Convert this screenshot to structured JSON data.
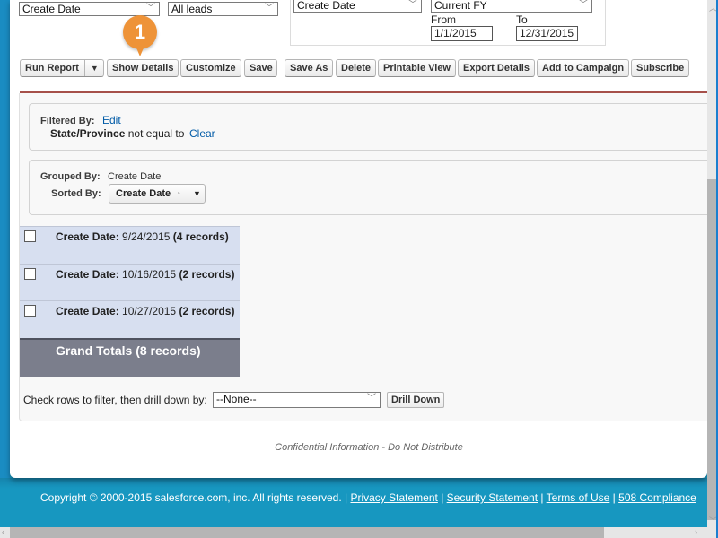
{
  "criteria": {
    "field_select": "Create Date",
    "show_select": "All leads",
    "date_field_select": "Create Date",
    "range_select": "Current FY",
    "from_label": "From",
    "from_value": "1/1/2015",
    "to_label": "To",
    "to_value": "12/31/2015"
  },
  "callout": {
    "number": "1"
  },
  "toolbar": {
    "run_report": "Run Report",
    "run_report_caret": "▼",
    "show_details": "Show Details",
    "customize": "Customize",
    "save": "Save",
    "save_as": "Save As",
    "delete": "Delete",
    "printable_view": "Printable View",
    "export_details": "Export Details",
    "add_to_campaign": "Add to Campaign",
    "subscribe": "Subscribe"
  },
  "filter": {
    "label": "Filtered By:",
    "edit_link": "Edit",
    "field": "State/Province",
    "operator": "not equal to",
    "clear_link": "Clear"
  },
  "grouping": {
    "grouped_label": "Grouped By:",
    "grouped_value": "Create Date",
    "sorted_label": "Sorted By:",
    "sorted_value": "Create Date",
    "sort_arrow": "↑",
    "sort_caret": "▼"
  },
  "groups": [
    {
      "label": "Create Date:",
      "value": "9/24/2015",
      "count": "(4 records)"
    },
    {
      "label": "Create Date:",
      "value": "10/16/2015",
      "count": "(2 records)"
    },
    {
      "label": "Create Date:",
      "value": "10/27/2015",
      "count": "(2 records)"
    }
  ],
  "grand_totals": "Grand Totals (8 records)",
  "drilldown": {
    "label": "Check rows to filter, then drill down by:",
    "select_value": "--None--",
    "button": "Drill Down"
  },
  "confidential": "Confidential Information - Do Not Distribute",
  "footer": {
    "copyright": "Copyright © 2000-2015 salesforce.com, inc. All rights reserved. |",
    "links": [
      "Privacy Statement",
      "Security Statement",
      "Terms of Use",
      "508 Compliance"
    ],
    "separator": "|"
  },
  "colors": {
    "brand_blue": "#1797c0",
    "report_rule": "#a6504a",
    "callout_orange": "#ee9338",
    "link_blue": "#015ba7",
    "group_row_bg": "#d7dff0",
    "grand_total_bg": "#7b7e8c"
  }
}
